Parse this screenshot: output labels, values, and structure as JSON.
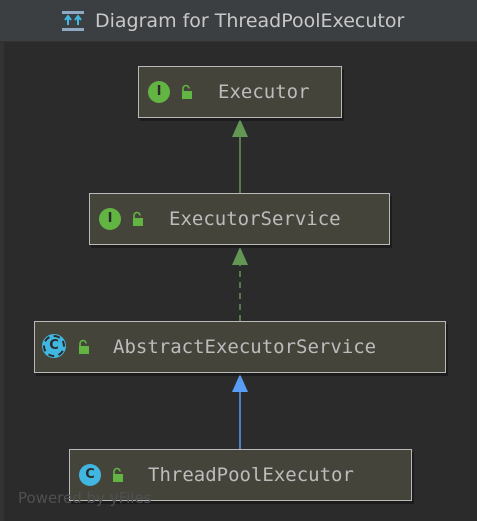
{
  "window": {
    "title": "Diagram for ThreadPoolExecutor"
  },
  "nodes": [
    {
      "label": "Executor",
      "kind": "interface",
      "badge": "I",
      "visibility": "public"
    },
    {
      "label": "ExecutorService",
      "kind": "interface",
      "badge": "I",
      "visibility": "public"
    },
    {
      "label": "AbstractExecutorService",
      "kind": "abstract-class",
      "badge": "C",
      "visibility": "public"
    },
    {
      "label": "ThreadPoolExecutor",
      "kind": "class",
      "badge": "C",
      "visibility": "public"
    }
  ],
  "edges": [
    {
      "from": "ExecutorService",
      "to": "Executor",
      "type": "extends",
      "style": "solid",
      "color": "#629755"
    },
    {
      "from": "AbstractExecutorService",
      "to": "ExecutorService",
      "type": "implements",
      "style": "dashed",
      "color": "#629755"
    },
    {
      "from": "ThreadPoolExecutor",
      "to": "AbstractExecutorService",
      "type": "extends",
      "style": "solid",
      "color": "#589df6"
    }
  ],
  "footer": {
    "watermark": "Powered by yFiles"
  },
  "colors": {
    "background": "#2b2b2b",
    "node_fill": "#45443b",
    "interface_badge": "#62b543",
    "class_badge": "#40b6e0",
    "inherit_arrow": "#589df6",
    "interface_arrow": "#629755"
  }
}
